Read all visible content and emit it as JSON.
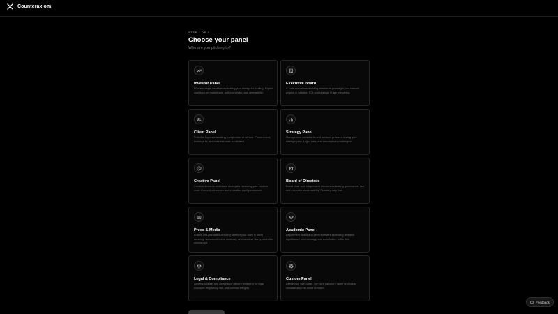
{
  "header": {
    "brand_name": "Counteraxiom",
    "logo_icon": "x-logo-icon"
  },
  "step": {
    "label": "STEP 1 OF 3",
    "title": "Choose your panel",
    "subtitle": "Who are you pitching to?"
  },
  "panels": [
    {
      "icon": "trending-up-icon",
      "title": "Investor Panel",
      "description": "VCs and angel investors evaluating your startup for funding. Expect questions on market size, unit economics, and defensibility."
    },
    {
      "icon": "building-icon",
      "title": "Executive Board",
      "description": "C-suite executives deciding whether to greenlight your internal project or initiative. ROI and strategic fit are everything."
    },
    {
      "icon": "users-icon",
      "title": "Client Panel",
      "description": "Potential buyers evaluating your product or service. Procurement, technical fit, and business case scrutinized."
    },
    {
      "icon": "bar-chart-icon",
      "title": "Strategy Panel",
      "description": "Management consultants and advisors pressure-testing your strategic plan. Logic, data, and assumptions challenged."
    },
    {
      "icon": "palette-icon",
      "title": "Creative Panel",
      "description": "Creative directors and brand strategists reviewing your creative work. Concept coherence and execution quality examined."
    },
    {
      "icon": "crown-icon",
      "title": "Board of Directors",
      "description": "Board chair and independent directors evaluating governance, risk, and executive accountability. Fiduciary duty first."
    },
    {
      "icon": "newspaper-icon",
      "title": "Press & Media",
      "description": "Editors and journalists deciding whether your story is worth covering. Newsworthiness, accuracy, and narrative clarity under the microscope."
    },
    {
      "icon": "graduation-cap-icon",
      "title": "Academic Panel",
      "description": "Department heads and peer reviewers assessing research significance, methodology, and contribution to the field."
    },
    {
      "icon": "scale-icon",
      "title": "Legal & Compliance",
      "description": "General counsel and compliance officers reviewing for legal exposure, regulatory risk, and contract integrity."
    },
    {
      "icon": "gear-icon",
      "title": "Custom Panel",
      "description": "Define your own panel. Set each panelist's name and role to simulate any real-world scenario."
    }
  ],
  "feedback": {
    "label": "Feedback",
    "icon": "message-icon"
  },
  "colors": {
    "background": "#000000",
    "card_background": "#080808",
    "card_border": "#262626",
    "muted_text": "#6e6e6e"
  }
}
